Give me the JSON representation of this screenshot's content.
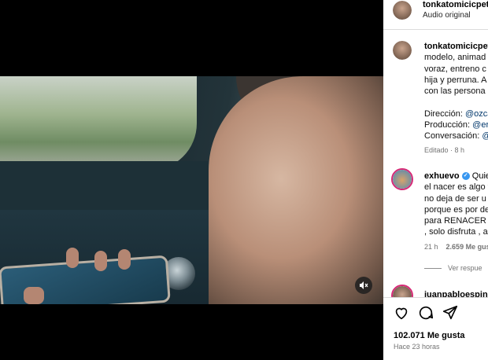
{
  "post": {
    "username": "tonkatomicicpet",
    "audio": "Audio original",
    "caption_lines": [
      "modelo, animad",
      "voraz, entreno c",
      "hija y perruna. A",
      "con las persona"
    ],
    "credits": [
      {
        "label": "Dirección:",
        "value": "@ozca"
      },
      {
        "label": "Producción:",
        "value": "@er"
      },
      {
        "label": "Conversación:",
        "value": "@"
      }
    ],
    "edited": "Editado · 8 h"
  },
  "comment": {
    "username": "exhuevo",
    "verified_mark": "✓",
    "first_text": "Quie",
    "lines": [
      "el nacer es algo f",
      "no deja de ser u",
      "porque es por de",
      "para RENACER , ",
      ", solo disfruta , al"
    ],
    "time": "21 h",
    "likes": "2.659 Me gust",
    "view_replies": "Ver respue"
  },
  "next_comment": {
    "username": "juanpabloespino"
  },
  "actions": {
    "like_count": "102.071 Me gusta",
    "posted": "Hace 23 horas"
  },
  "icons": [
    "heart-icon",
    "comment-icon",
    "share-icon",
    "mute-icon",
    "verified-badge-icon"
  ],
  "colors": {
    "link": "#00376b",
    "muted": "#737373",
    "verified": "#3897f0"
  }
}
